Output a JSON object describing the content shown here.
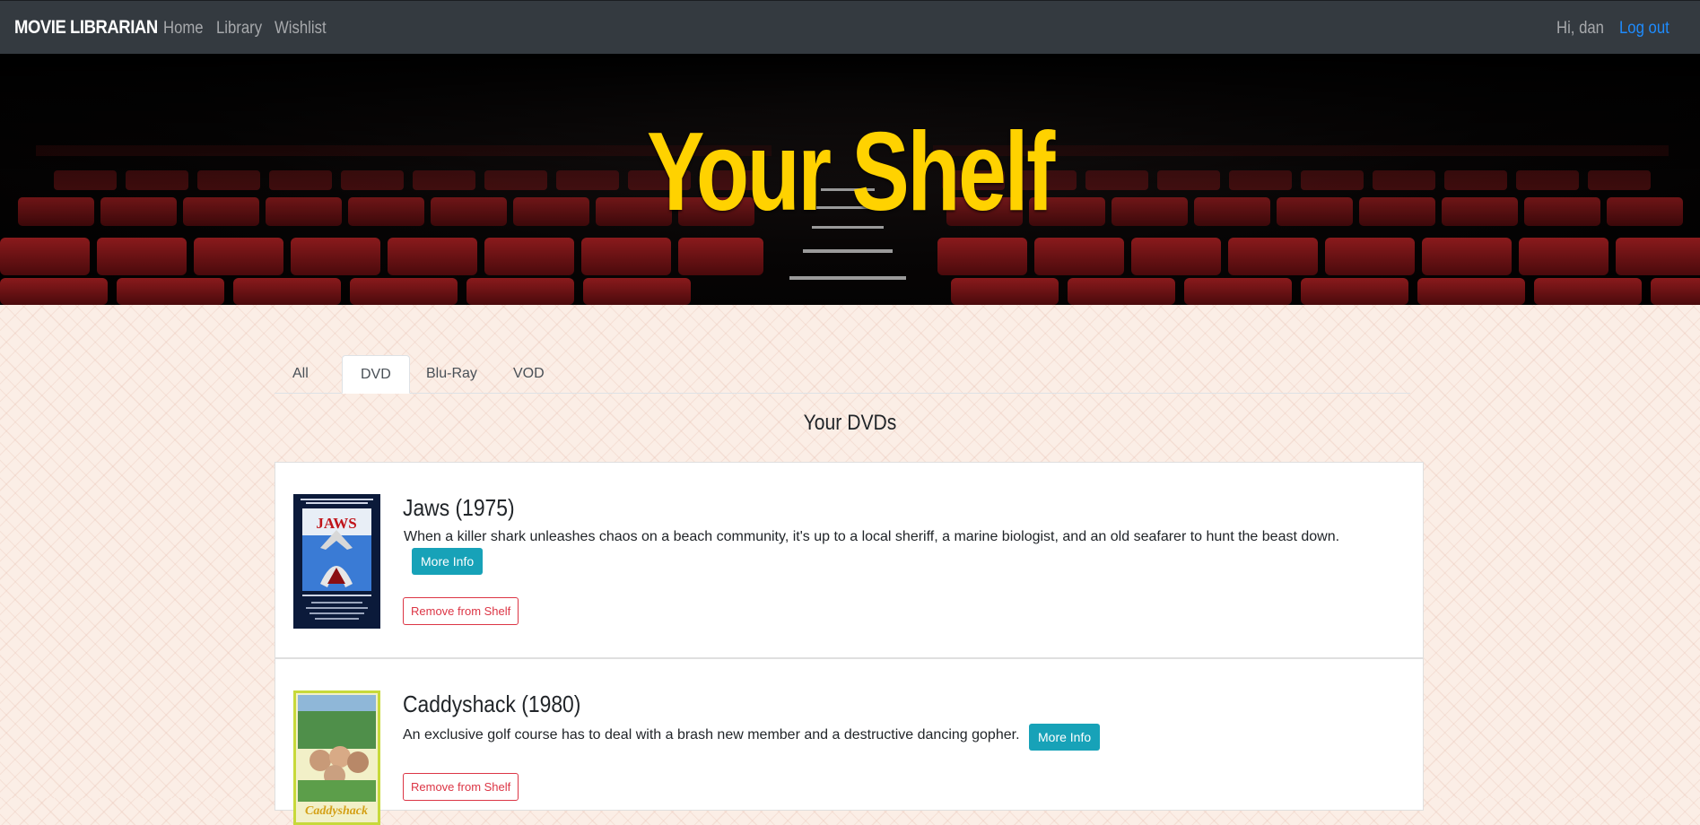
{
  "navbar": {
    "brand": "MOVIE LIBRARIAN",
    "links": [
      "Home",
      "Library",
      "Wishlist"
    ],
    "greeting": "Hi, dan",
    "logout": "Log out"
  },
  "hero": {
    "title": "Your Shelf"
  },
  "tabs": [
    {
      "label": "All",
      "active": false
    },
    {
      "label": "DVD",
      "active": true
    },
    {
      "label": "Blu-Ray",
      "active": false
    },
    {
      "label": "VOD",
      "active": false
    }
  ],
  "section_title": "Your DVDs",
  "movies": [
    {
      "title": "Jaws (1975)",
      "description": "When a killer shark unleashes chaos on a beach community, it's up to a local sheriff, a marine biologist, and an old seafarer to hunt the beast down.",
      "more_info": "More Info",
      "remove": "Remove from Shelf",
      "poster_text": "JAWS"
    },
    {
      "title": "Caddyshack (1980)",
      "description": "An exclusive golf course has to deal with a brash new member and a destructive dancing gopher.",
      "more_info": "More Info",
      "remove": "Remove from Shelf",
      "poster_text": "Caddyshack"
    }
  ],
  "colors": {
    "navbar_bg": "#343a40",
    "hero_title": "#ffd200",
    "info_button": "#17a2b8",
    "danger": "#dc3545",
    "link": "#1e8cff"
  }
}
